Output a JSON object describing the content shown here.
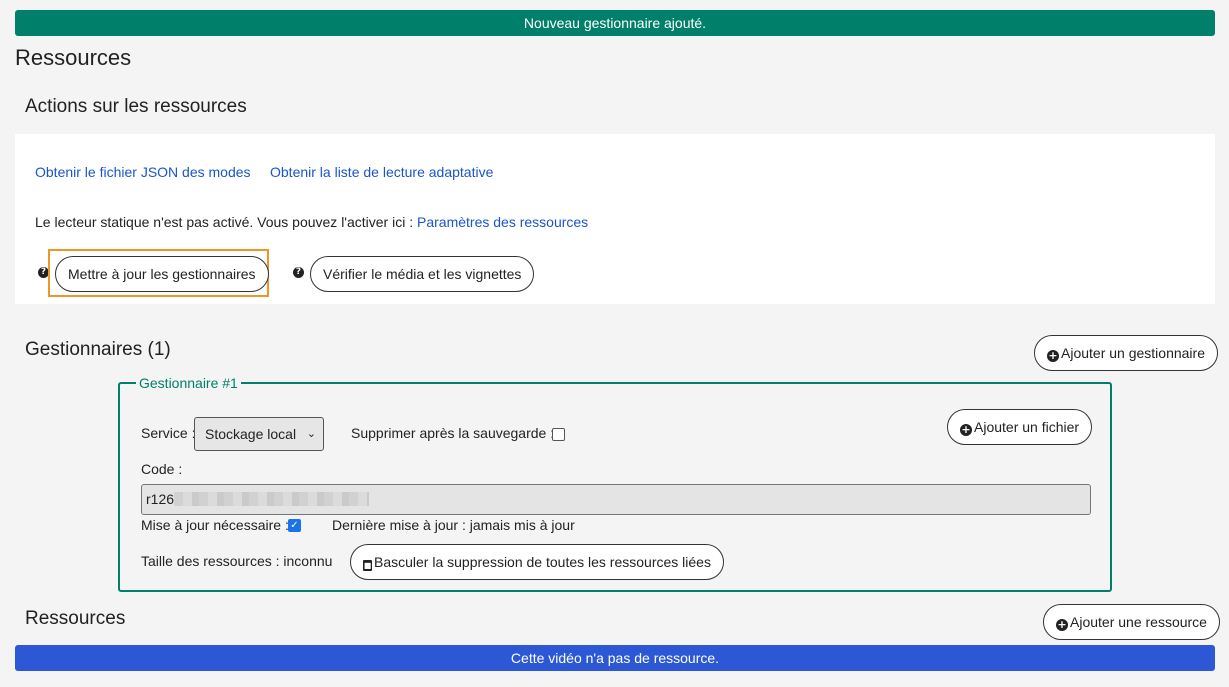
{
  "alerts": {
    "success": "Nouveau gestionnaire ajouté.",
    "info": "Cette vidéo n'a pas de ressource."
  },
  "page": {
    "title": "Ressources"
  },
  "actions": {
    "title": "Actions sur les ressources",
    "link_json": "Obtenir le fichier JSON des modes",
    "link_adaptive": "Obtenir la liste de lecture adaptative",
    "static_note": "Le lecteur statique n'est pas activé. Vous pouvez l'activer ici : ",
    "settings_link": "Paramètres des ressources",
    "update_button": "Mettre à jour les gestionnaires",
    "verify_button": "Vérifier le média et les vignettes",
    "help_glyph": "?"
  },
  "managers": {
    "title": "Gestionnaires (1)",
    "add_button": "Ajouter un gestionnaire",
    "items": [
      {
        "legend": "Gestionnaire #1",
        "service_label": "Service :",
        "service_value": "Stockage local",
        "delete_after_label": "Supprimer après la sauvegarde :",
        "delete_after_checked": false,
        "add_file_button": "Ajouter un fichier",
        "code_label": "Code :",
        "code_value": "r126",
        "update_needed_label": "Mise à jour nécessaire :",
        "update_needed_checked": true,
        "last_update": "Dernière mise à jour : jamais mis à jour",
        "size": "Taille des ressources : inconnu",
        "toggle_delete_button": "Basculer la suppression de toutes les ressources liées"
      }
    ]
  },
  "resources": {
    "title": "Ressources",
    "add_button": "Ajouter une ressource"
  },
  "icons": {
    "plus": "plus-circle-icon",
    "trash": "trash-icon",
    "help": "question-circle-icon",
    "chevron": "chevron-down-icon",
    "check": "checkmark-icon"
  }
}
